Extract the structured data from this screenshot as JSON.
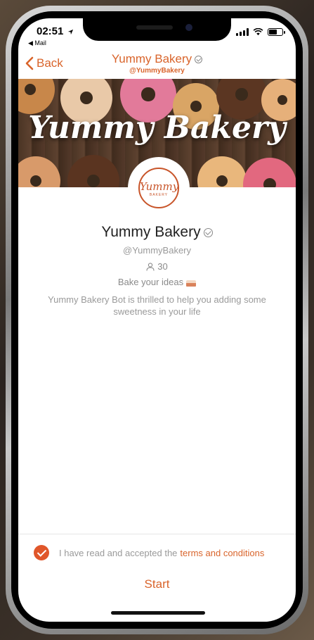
{
  "status_bar": {
    "time": "02:51",
    "back_app": "◀ Mail"
  },
  "nav": {
    "back_label": "Back",
    "title": "Yummy Bakery",
    "handle": "@YummyBakery"
  },
  "banner": {
    "title": "Yummy Bakery"
  },
  "avatar": {
    "logo_text": "Yummy",
    "logo_sub": "BAKERY"
  },
  "profile": {
    "name": "Yummy Bakery",
    "handle": "@YummyBakery",
    "subscribers": "30",
    "tagline": "Bake your ideas",
    "description": "Yummy Bakery Bot is thrilled to help you adding some sweetness in your life"
  },
  "footer": {
    "terms_text": "I have read and accepted the",
    "terms_link": "terms and conditions",
    "start_label": "Start"
  },
  "colors": {
    "accent": "#d9642b",
    "checkbox": "#e0562a"
  },
  "icons": {
    "back": "chevron-left-icon",
    "verified": "verified-check-icon",
    "subscribers": "person-icon",
    "tagline": "cake-icon",
    "checkbox": "check-icon"
  }
}
